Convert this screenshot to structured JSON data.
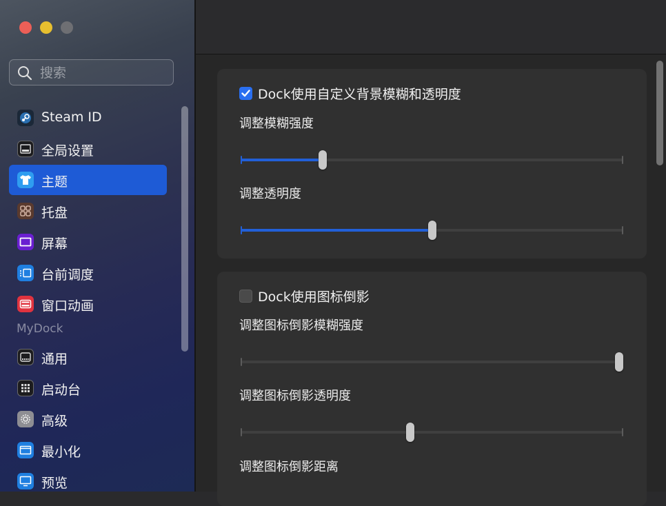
{
  "sidebar": {
    "search_placeholder": "搜索",
    "items": [
      {
        "label": "Steam ID",
        "icon": "steam-icon",
        "color": "#1b2838"
      },
      {
        "label": "全局设置",
        "icon": "display-icon",
        "color": "#3a3a3c"
      },
      {
        "label": "主题",
        "icon": "tshirt-icon",
        "color": "#2f9df0"
      },
      {
        "label": "托盘",
        "icon": "grid-icon",
        "color": "#5a3a2e"
      },
      {
        "label": "屏幕",
        "icon": "screen-icon",
        "color": "#6a1fd1"
      },
      {
        "label": "台前调度",
        "icon": "stage-manager-icon",
        "color": "#1f7fe0"
      },
      {
        "label": "窗口动画",
        "icon": "window-animation-icon",
        "color": "#e0333f"
      }
    ],
    "section_label": "MyDock",
    "mydock_items": [
      {
        "label": "通用",
        "icon": "dock-general-icon",
        "color": "#2f2f31"
      },
      {
        "label": "启动台",
        "icon": "launchpad-icon",
        "color": "#2a2a2c"
      },
      {
        "label": "高级",
        "icon": "gear-icon",
        "color": "#8e8e93"
      },
      {
        "label": "最小化",
        "icon": "minimize-icon",
        "color": "#1f7fe0"
      },
      {
        "label": "预览",
        "icon": "preview-icon",
        "color": "#1f7fe0"
      }
    ],
    "active_index": 2
  },
  "main": {
    "card1": {
      "checkbox_label": "Dock使用自定义背景模糊和透明度",
      "checked": true,
      "sliders": [
        {
          "label": "调整模糊强度",
          "value": 0.214
        },
        {
          "label": "调整透明度",
          "value": 0.5
        }
      ]
    },
    "card2": {
      "checkbox_label": "Dock使用图标倒影",
      "checked": false,
      "sliders": [
        {
          "label": "调整图标倒影模糊强度",
          "value": 1.0
        },
        {
          "label": "调整图标倒影透明度",
          "value": 0.443
        }
      ],
      "extra_label": "调整图标倒影距离"
    }
  },
  "colors": {
    "accent": "#1e5bd6",
    "slider_fill": "#2260d8"
  }
}
